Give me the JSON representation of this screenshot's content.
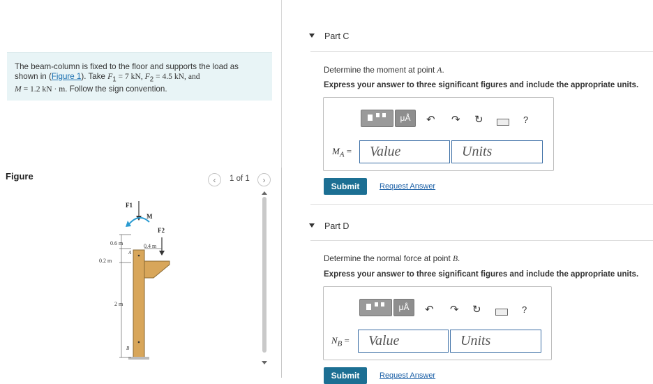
{
  "problem": {
    "line1": "The beam-column is fixed to the floor and supports the load as",
    "line2_pre": "shown in (",
    "figure_link": "Figure 1",
    "line2_post": "). Take ",
    "f1": "F",
    "f1_sub": "1",
    "f1_val": " = 7 kN, ",
    "f2": "F",
    "f2_sub": "2",
    "f2_val": " = 4.5 kN, and",
    "m_var": "M",
    "m_val": " = 1.2 kN · m",
    "line3_post": ". Follow the sign convention."
  },
  "figure": {
    "title": "Figure",
    "pager": "1 of 1",
    "labels": {
      "f1": "F1",
      "m": "M",
      "f2": "F2",
      "d06": "0.6 m",
      "d04": "0.4 m",
      "a": "A",
      "d02": "0.2 m",
      "d2": "2 m",
      "b": "B"
    }
  },
  "partC": {
    "title": "Part C",
    "question_pre": "Determine the moment at point ",
    "question_point": "A",
    "question_post": ".",
    "instruction": "Express your answer to three significant figures and include the appropriate units.",
    "var_label": "M",
    "var_sub": "A",
    "eq": " =",
    "value_placeholder": "Value",
    "units_placeholder": "Units",
    "submit": "Submit",
    "request": "Request Answer",
    "mu_label": "μÅ",
    "help": "?"
  },
  "partD": {
    "title": "Part D",
    "question_pre": "Determine the normal force at point ",
    "question_point": "B",
    "question_post": ".",
    "instruction": "Express your answer to three significant figures and include the appropriate units.",
    "var_label": "N",
    "var_sub": "B",
    "eq": " =",
    "value_placeholder": "Value",
    "units_placeholder": "Units",
    "submit": "Submit",
    "request": "Request Answer",
    "mu_label": "μÅ",
    "help": "?"
  }
}
